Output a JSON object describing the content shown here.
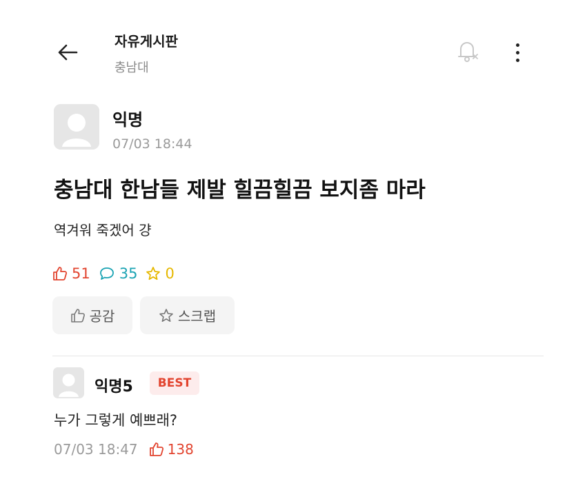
{
  "header": {
    "title": "자유게시판",
    "subtitle": "충남대"
  },
  "post": {
    "author": "익명",
    "time": "07/03 18:44",
    "title": "충남대 한남들 제발 힐끔힐끔 보지좀 마라",
    "body": "역겨워 죽겠어 걍",
    "stats": {
      "likes": "51",
      "comments": "35",
      "scraps": "0"
    },
    "actions": {
      "like_label": "공감",
      "scrap_label": "스크랩"
    }
  },
  "comment": {
    "author": "익명5",
    "badge": "BEST",
    "body": "누가 그렇게 예쁘래?",
    "time": "07/03 18:47",
    "likes": "138"
  },
  "colors": {
    "like": "#e2442f",
    "comment": "#1aa3b3",
    "scrap": "#e6b800",
    "best_bg": "#fdecec"
  },
  "icons": {
    "back": "arrow-left-icon",
    "bell": "bell-off-icon",
    "more": "more-vertical-icon",
    "like": "thumbs-up-icon",
    "comment": "speech-bubble-icon",
    "scrap": "star-icon"
  }
}
